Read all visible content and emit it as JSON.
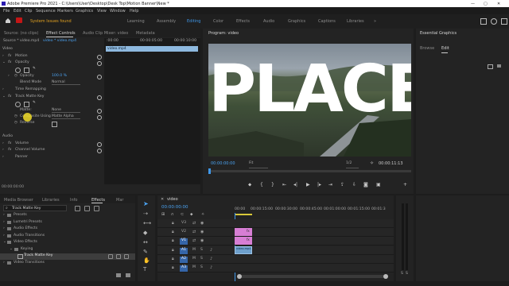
{
  "window": {
    "title": "Adobe Premiere Pro 2021 - C:\\Users\\User\\Desktop\\Desk Top\\Motion Banner\\New *",
    "controls": [
      "—",
      "▢",
      "✕"
    ]
  },
  "menu": [
    "File",
    "Edit",
    "Clip",
    "Sequence",
    "Markers",
    "Graphics",
    "View",
    "Window",
    "Help"
  ],
  "workspaces": {
    "items": [
      "Learning",
      "Assembly",
      "Editing",
      "Color",
      "Effects",
      "Audio",
      "Graphics",
      "Captions",
      "Libraries"
    ],
    "active": "Editing",
    "more": "»"
  },
  "effect_controls": {
    "tabs": [
      "Source: (no clips)",
      "Effect Controls",
      "Audio Clip Mixer: video",
      "Metadata"
    ],
    "active_tab": "Effect Controls",
    "source": "Source * video.mp4",
    "clip": "video * video.mp4",
    "mini_clip": "video.mp4",
    "ruler": [
      ":00:00",
      "00:00:05:00",
      "00:00:10:00"
    ],
    "rows": [
      {
        "label": "Video",
        "indent": 1
      },
      {
        "label": "Motion",
        "indent": 4,
        "fx": true
      },
      {
        "label": "Opacity",
        "indent": 4,
        "fx": true
      },
      {
        "label": "Opacity",
        "indent": 12,
        "value": "100.0 %"
      },
      {
        "label": "Blend Mode",
        "indent": 12,
        "value": "Normal"
      },
      {
        "label": "Time Remapping",
        "indent": 4,
        "fx": true
      },
      {
        "label": "Track Matte Key",
        "indent": 4,
        "fx": true
      },
      {
        "label": "Matte:",
        "indent": 12,
        "value": "None"
      },
      {
        "label": "Composite Using",
        "indent": 12,
        "value": "Matte Alpha"
      },
      {
        "label": "Reverse",
        "indent": 12
      },
      {
        "label": "Audio",
        "indent": 1
      },
      {
        "label": "Volume",
        "indent": 4,
        "fx": true
      },
      {
        "label": "Channel Volume",
        "indent": 4,
        "fx": true
      },
      {
        "label": "Panner",
        "indent": 4,
        "fx": true
      }
    ],
    "timecode": "00:00:00:00"
  },
  "program": {
    "title": "Program: video",
    "overlay_text": "PLACE",
    "timecode_left": "00:00:00:00",
    "fit": "Fit",
    "resolution": "1/2",
    "timecode_right": "00:00:11:13"
  },
  "essential": {
    "title": "Essential Graphics",
    "tabs": [
      "Browse",
      "Edit"
    ],
    "active": "Edit"
  },
  "effects_panel": {
    "tabs": [
      "Media Browser",
      "Libraries",
      "Info",
      "Effects",
      "Mar"
    ],
    "active": "Effects",
    "search": "Track Matte Key",
    "tree": [
      {
        "label": "Presets",
        "level": 0
      },
      {
        "label": "Lumetri Presets",
        "level": 0
      },
      {
        "label": "Audio Effects",
        "level": 0
      },
      {
        "label": "Audio Transitions",
        "level": 0
      },
      {
        "label": "Video Effects",
        "level": 0,
        "open": true
      },
      {
        "label": "Keying",
        "level": 1,
        "open": true
      },
      {
        "label": "Track Matte Key",
        "level": 2,
        "selected": true
      },
      {
        "label": "Video Transitions",
        "level": 0
      }
    ]
  },
  "timeline": {
    "title": "video",
    "timecode": "00:00:00:00",
    "ruler": [
      "00:00",
      "00:00:15:00",
      "00:00:30:00",
      "00:00:45:00",
      "00:01:00:00",
      "00:01:15:00",
      "00:01:3"
    ],
    "tracks": [
      "V3",
      "V2",
      "V1",
      "A1",
      "A2",
      "A3"
    ],
    "track_buttons": [
      "M",
      "S"
    ],
    "fx_badge": "fx",
    "clip_a1_label": "video.mp4",
    "meter_labels": [
      "S",
      "S"
    ]
  },
  "alert": {
    "text": "System Issues found"
  }
}
